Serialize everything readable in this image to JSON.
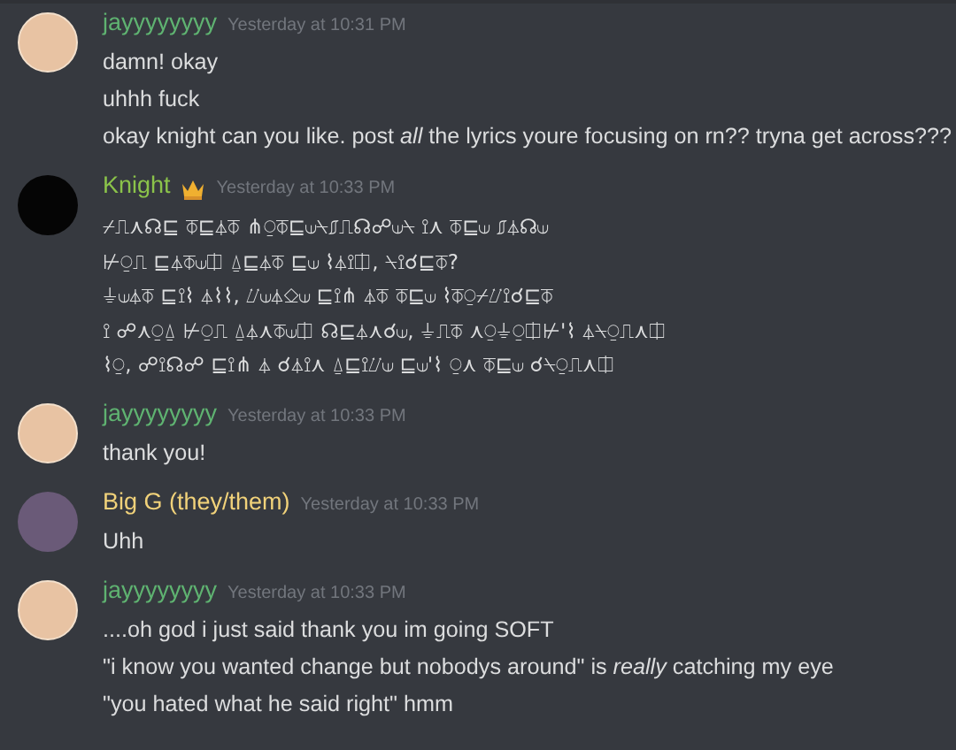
{
  "messages": [
    {
      "author": "jayyyyyyyy",
      "color": "#5fb371",
      "avatar": {
        "kind": "sketch"
      },
      "timestamp": "Yesterday at 10:31 PM",
      "blocks": [
        [
          "damn! okay"
        ],
        [
          "uhhh fuck"
        ],
        [
          "okay knight can you like. post *all* the lyrics youre focusing on rn?? tryna get across???"
        ]
      ]
    },
    {
      "author": "Knight",
      "color": "#8bc34a",
      "avatar": {
        "kind": "dark"
      },
      "badge": {
        "kind": "crown"
      },
      "timestamp": "Yesterday at 10:33 PM",
      "blocks": [
        [
          "⌿⎍⋏☊⊑ ⏁⊑⏃⏁ ⋔⍜⏁⊑⟒⍀⎎⎍☊☍⟒⍀ ⟟⋏ ⏁⊑⟒ ⎎⏃☊⟒",
          "⊬⍜⎍ ⊑⏃⏁⟒⎅ ⍙⊑⏃⏁ ⊑⟒ ⌇⏃⟟⎅, ⍀⟟☌⊑⏁?",
          "⏚⟒⏃⏁ ⊑⟟⌇ ⏃⌇⌇, ⌰⟒⏃⎐⟒ ⊑⟟⋔ ⏃⏁ ⏁⊑⟒ ⌇⏁⍜⌿⌰⟟☌⊑⏁",
          "⟟ ☍⋏⍜⍙ ⊬⍜⎍ ⍙⏃⋏⏁⟒⎅ ☊⊑⏃⋏☌⟒, ⏚⎍⏁ ⋏⍜⏚⍜⎅⊬'⌇ ⏃⍀⍜⎍⋏⎅",
          "⌇⍜, ☍⟟☊☍ ⊑⟟⋔ ⏃ ☌⏃⟟⋏ ⍙⊑⟟⌰⟒ ⊑⟒'⌇ ⍜⋏ ⏁⊑⟒ ☌⍀⍜⎍⋏⎅"
        ]
      ]
    },
    {
      "author": "jayyyyyyyy",
      "color": "#5fb371",
      "avatar": {
        "kind": "sketch"
      },
      "timestamp": "Yesterday at 10:33 PM",
      "blocks": [
        [
          "thank you!"
        ]
      ]
    },
    {
      "author": "Big G (they/them)",
      "color": "#f1d27a",
      "avatar": {
        "kind": "portrait"
      },
      "timestamp": "Yesterday at 10:33 PM",
      "blocks": [
        [
          "Uhh"
        ]
      ]
    },
    {
      "author": "jayyyyyyyy",
      "color": "#5fb371",
      "avatar": {
        "kind": "sketch"
      },
      "timestamp": "Yesterday at 10:33 PM",
      "blocks": [
        [
          "....oh god i just said thank you im going SOFT"
        ],
        [
          "\"i know you wanted change but nobodys around\" is *really* catching my eye"
        ],
        [
          "\"you hated what he said right\" hmm"
        ]
      ]
    }
  ]
}
